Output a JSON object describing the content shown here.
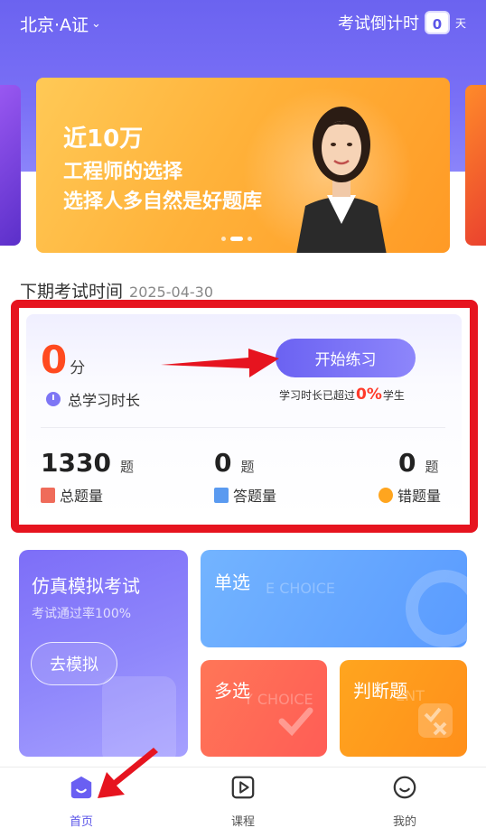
{
  "header": {
    "city": "北京·A证",
    "countdown_label": "考试倒计时",
    "countdown_value": "0",
    "countdown_unit": "天"
  },
  "banner": {
    "line1": "近10万",
    "line2": "工程师的选择",
    "line3": "选择人多自然是好题库"
  },
  "next_exam": {
    "label": "下期考试时间",
    "date": "2025-04-30"
  },
  "stats": {
    "score": "0",
    "score_unit": "分",
    "study_time_label": "总学习时长",
    "start_button": "开始练习",
    "beat_prefix": "学习时长已超过",
    "beat_percent": "0%",
    "beat_suffix": "学生",
    "totals": [
      {
        "value": "1330",
        "unit": "题",
        "label": "总题量"
      },
      {
        "value": "0",
        "unit": "题",
        "label": "答题量"
      },
      {
        "value": "0",
        "unit": "题",
        "label": "错题量"
      }
    ]
  },
  "modes": {
    "mock": {
      "title": "仿真模拟考试",
      "subtitle": "考试通过率100%",
      "button": "去模拟"
    },
    "single": {
      "title": "单选",
      "watermark": "E CHOICE"
    },
    "multi": {
      "title": "多选",
      "watermark": "Y CHOICE"
    },
    "judge": {
      "title": "判断题",
      "watermark": "ENT"
    }
  },
  "tabbar": {
    "items": [
      {
        "label": "首页",
        "icon": "home-icon"
      },
      {
        "label": "课程",
        "icon": "course-play-icon"
      },
      {
        "label": "我的",
        "icon": "smile-profile-icon"
      }
    ],
    "active": "首页"
  },
  "colors": {
    "header": "#6b63f0",
    "accent": "#5b55e8",
    "score": "#ff4a1f",
    "annotation_red": "#e6141f"
  }
}
